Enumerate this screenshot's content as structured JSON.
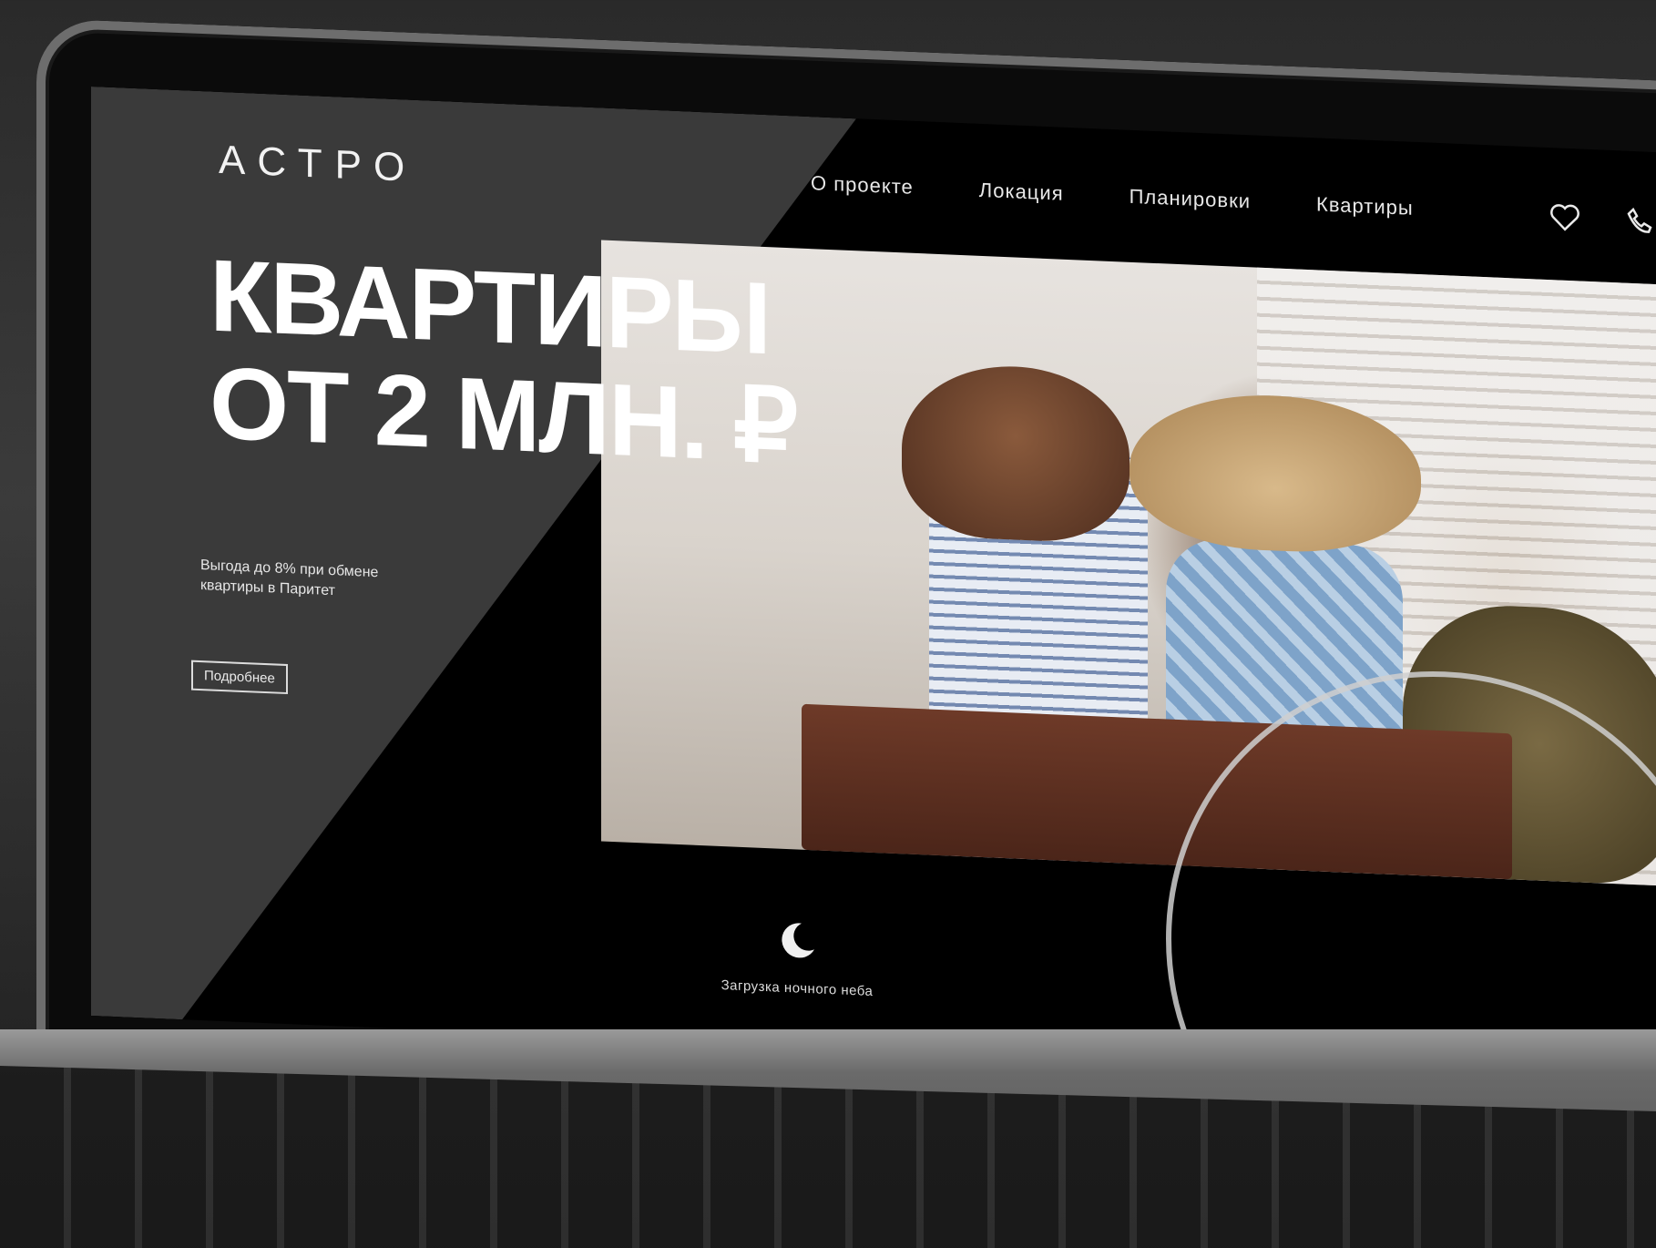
{
  "header": {
    "logo_text": "АСТРО",
    "nav": [
      "О проекте",
      "Локация",
      "Планировки",
      "Квартиры"
    ],
    "icons": [
      "heart-icon",
      "phone-icon"
    ]
  },
  "hero": {
    "headline_line1": "КВАРТИРЫ",
    "headline_line2": "ОТ 2 МЛН. ₽",
    "promo": "Выгода до 8% при обмене квартиры в Паритет",
    "details_button": "Подробнее"
  },
  "footer": {
    "loader_caption": "Загрузка ночного неба"
  },
  "colors": {
    "background": "#000000",
    "panel": "#3a3a3a",
    "text": "#ffffff"
  }
}
